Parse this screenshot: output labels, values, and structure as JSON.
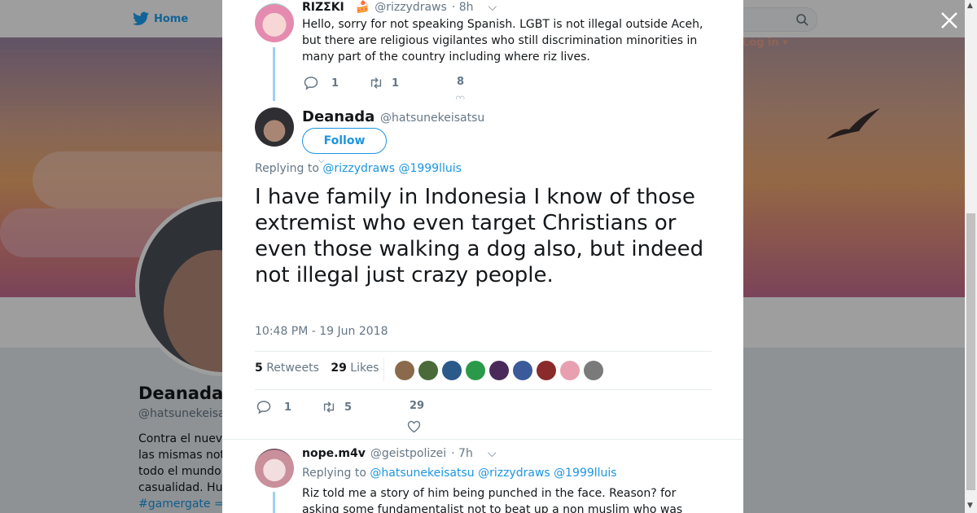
{
  "background": {
    "nav": {
      "home_label": "Home",
      "login_label": "Log in"
    },
    "profile": {
      "name": "Deanada",
      "handle": "@hatsunekeisa",
      "bio_lines": [
        "Contra el nuev",
        "las mismas not",
        "todo el mundo",
        "casualidad. Hu"
      ],
      "hashtag": "#gamergate ="
    }
  },
  "modal": {
    "parent_tweet": {
      "name": "RIZΣKI",
      "emoji": "🍰",
      "handle": "@rizzydraws",
      "time": "· 8h",
      "text": "Hello, sorry for not speaking Spanish. LGBT is not illegal outside Aceh, but there are religious vigilantes who still discrimination minorities in many part of the country including where riz lives.",
      "replies": "1",
      "retweets": "1",
      "likes": "8"
    },
    "main_tweet": {
      "name": "Deanada",
      "handle": "@hatsunekeisatsu",
      "follow_label": "Follow",
      "replying_prefix": "Replying to",
      "replying_to": [
        "@rizzydraws",
        "@1999lluis"
      ],
      "text": "I have family in Indonesia I know of those extremist who even target Christians or even those walking a dog also, but indeed not illegal just crazy people.",
      "timestamp": "10:48 PM - 19 Jun 2018",
      "retweets_count": "5",
      "retweets_label": "Retweets",
      "likes_count": "29",
      "likes_label": "Likes",
      "replies": "1",
      "retweet_action": "5",
      "like_action": "29"
    },
    "reply_tweet": {
      "name": "nope.m4v",
      "handle": "@geistpolizei",
      "time": "· 7h",
      "replying_prefix": "Replying to",
      "replying_to": [
        "@hatsunekeisatsu",
        "@rizzydraws",
        "@1999lluis"
      ],
      "text_line1": "Riz told me a story of him being punched in the face. Reason? for",
      "text_line2": "asking some fundamentalist not to beat up a non muslim who was"
    },
    "liker_avatars": [
      "#8a6a4a",
      "#4a6a3a",
      "#2a5a8a",
      "#2a9a4a",
      "#4a2a5a",
      "#3a5a9a",
      "#8a2a2a",
      "#e8a0b0",
      "#7a7a7a"
    ]
  },
  "colors": {
    "accent": "#1b95e0",
    "text": "#14171a",
    "muted": "#657786"
  }
}
